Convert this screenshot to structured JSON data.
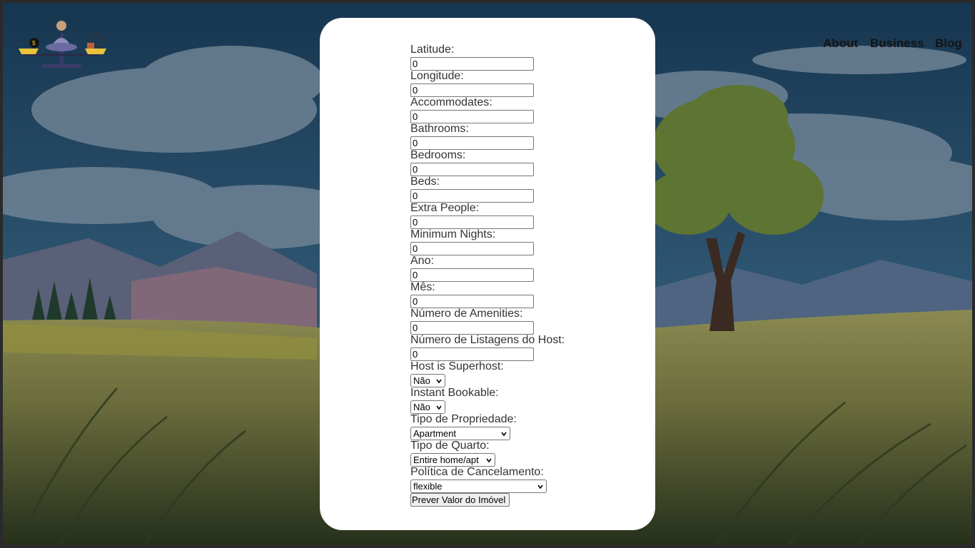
{
  "nav": {
    "about": "About",
    "business": "Business",
    "blog": "Blog"
  },
  "form": {
    "fields": [
      {
        "label": "Latitude:",
        "value": "0"
      },
      {
        "label": "Longitude:",
        "value": "0"
      },
      {
        "label": "Accommodates:",
        "value": "0"
      },
      {
        "label": "Bathrooms:",
        "value": "0"
      },
      {
        "label": "Bedrooms:",
        "value": "0"
      },
      {
        "label": "Beds:",
        "value": "0"
      },
      {
        "label": "Extra People:",
        "value": "0"
      },
      {
        "label": "Minimum Nights:",
        "value": "0"
      },
      {
        "label": "Ano:",
        "value": "0"
      },
      {
        "label": "Mês:",
        "value": "0"
      },
      {
        "label": "Número de Amenities:",
        "value": "0"
      },
      {
        "label": "Número de Listagens do Host:",
        "value": "0"
      }
    ],
    "selects": [
      {
        "label": "Host is Superhost:",
        "value": "Não"
      },
      {
        "label": "Instant Bookable:",
        "value": "Não"
      },
      {
        "label": "Tipo de Propriedade:",
        "value": "Apartment"
      },
      {
        "label": "Tipo de Quarto:",
        "value": "Entire home/apt"
      },
      {
        "label": "Política de Cancelamento:",
        "value": "flexible"
      }
    ],
    "submit_label": "Prever Valor do Imóvel"
  },
  "colors": {
    "card": "#ffffff",
    "text": "#333333",
    "nav_text": "#141414"
  }
}
